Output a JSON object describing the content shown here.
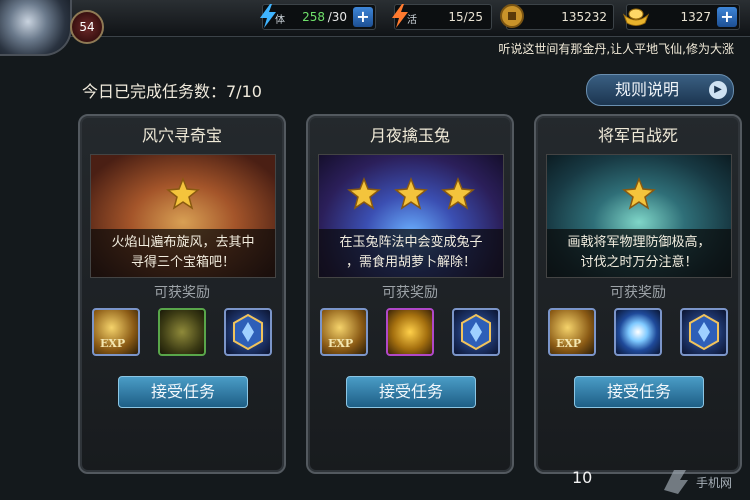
{
  "player": {
    "level": "54"
  },
  "resources": {
    "stamina": {
      "label": "体",
      "value": "258",
      "max": "/30"
    },
    "vitality": {
      "label": "活",
      "value": "15/25"
    },
    "coins": {
      "value": "135232"
    },
    "ingots": {
      "value": "1327"
    }
  },
  "news_ticker": "听说这世间有那金丹,让人平地飞仙,修为大涨",
  "progress_text": "今日已完成任务数：7/10",
  "rules_button": "规则说明",
  "reward_label": "可获奖励",
  "accept_label": "接受任务",
  "quests": [
    {
      "title": "风穴寻奇宝",
      "stars": 1,
      "desc_line1": "火焰山遍布旋风，去其中",
      "desc_line2": "寻得三个宝箱吧！"
    },
    {
      "title": "月夜擒玉兔",
      "stars": 3,
      "desc_line1": "在玉兔阵法中会变成兔子",
      "desc_line2": "，需食用胡萝卜解除！"
    },
    {
      "title": "将军百战死",
      "stars": 1,
      "desc_line1": "画戟将军物理防御极高，",
      "desc_line2": "讨伐之时万分注意！"
    }
  ],
  "rewards_text": {
    "exp": "EXP"
  },
  "footer_text": "10",
  "watermark_text": "手机网",
  "colors": {
    "accent_blue": "#2f7fb0",
    "star_gold": "#f4c43c",
    "panel": "#1f2427"
  }
}
